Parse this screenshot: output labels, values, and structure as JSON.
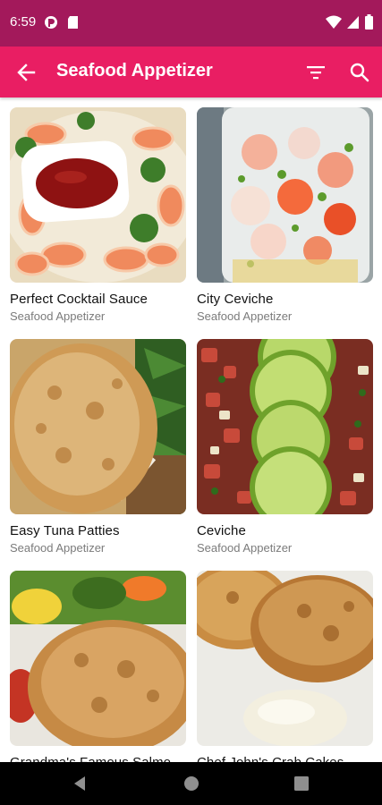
{
  "status_bar": {
    "time": "6:59",
    "icons": [
      "app-notification-icon",
      "sd-card-icon",
      "wifi-icon",
      "cell-signal-icon",
      "battery-icon"
    ]
  },
  "app_bar": {
    "title": "Seafood Appetizer",
    "icons": [
      "back-arrow-icon",
      "filter-icon",
      "search-icon"
    ]
  },
  "recipes": [
    {
      "title": "Perfect Cocktail Sauce",
      "category": "Seafood Appetizer"
    },
    {
      "title": "City Ceviche",
      "category": "Seafood Appetizer"
    },
    {
      "title": "Easy Tuna Patties",
      "category": "Seafood Appetizer"
    },
    {
      "title": "Ceviche",
      "category": "Seafood Appetizer"
    },
    {
      "title": "Grandma's Famous Salmo",
      "category": ""
    },
    {
      "title": "Chef John's Crab Cakes",
      "category": ""
    }
  ],
  "nav_bar": {
    "icons": [
      "nav-back-icon",
      "nav-home-icon",
      "nav-recents-icon"
    ]
  },
  "colors": {
    "status_bar": "#a3195b",
    "app_bar": "#e91e63",
    "title_text": "#111111",
    "subtitle_text": "#7b7b7b"
  }
}
